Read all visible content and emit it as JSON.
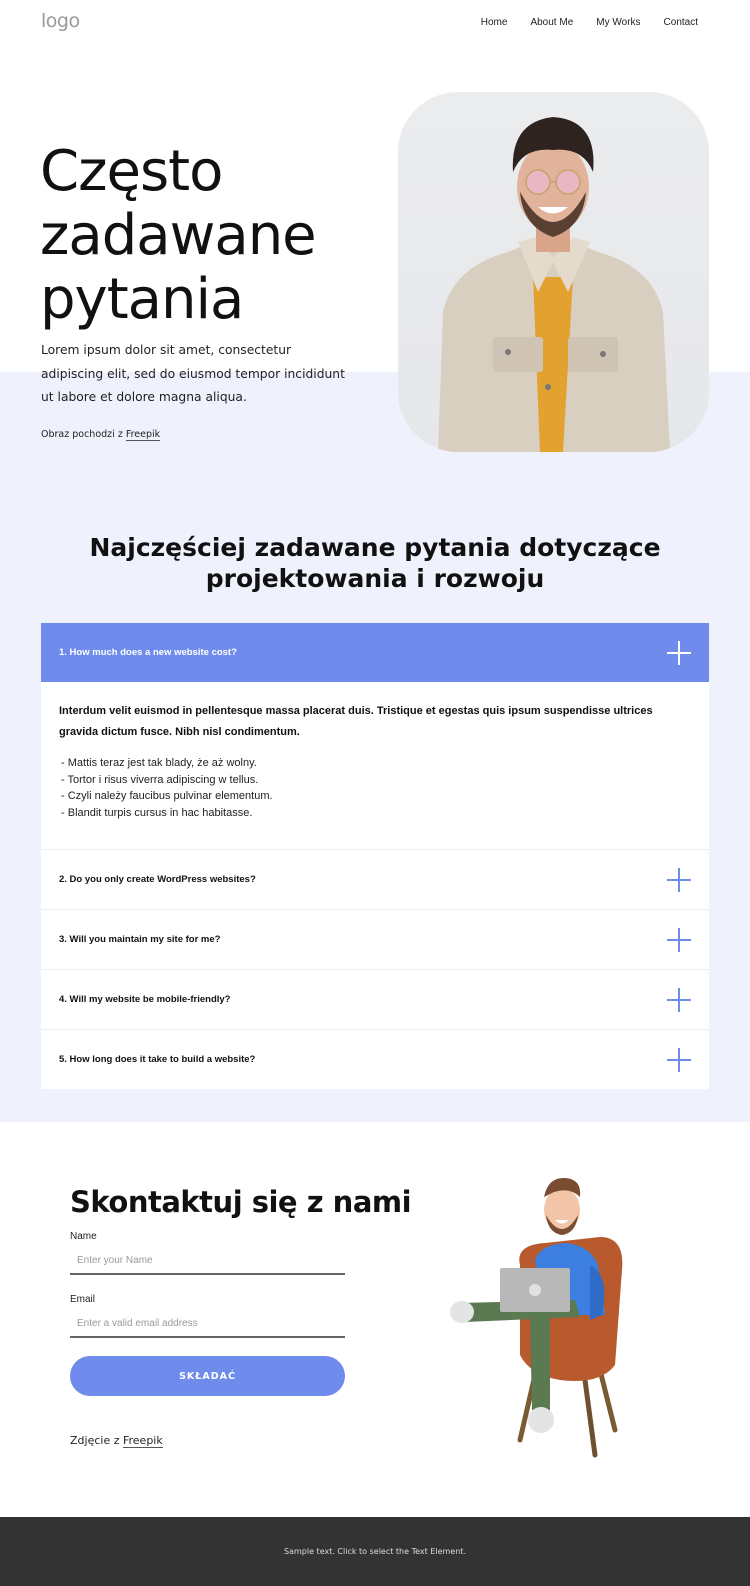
{
  "header": {
    "logo": "logo",
    "nav": [
      {
        "label": "Home"
      },
      {
        "label": "About Me"
      },
      {
        "label": "My Works"
      },
      {
        "label": "Contact"
      }
    ]
  },
  "hero": {
    "title_lines": [
      "Często",
      "zadawane",
      "pytania"
    ],
    "text": "Lorem ipsum dolor sit amet, consectetur adipiscing elit, sed do eiusmod tempor incididunt ut labore et dolore magna aliqua.",
    "credit_prefix": "Obraz pochodzi z ",
    "credit_link": "Freepik",
    "image_alt": "smiling man in beige denim jacket and pink glasses"
  },
  "faq": {
    "title_line1": "Najczęściej zadawane pytania dotyczące",
    "title_line2": "projektowania i rozwoju",
    "items": [
      {
        "question": "1. How much does a new website cost?",
        "expanded": true,
        "answer_lead": "Interdum velit euismod in pellentesque massa placerat duis. Tristique et egestas quis ipsum suspendisse ultrices gravida dictum fusce. Nibh nisl condimentum.",
        "answer_list": [
          "Mattis teraz jest tak blady, że aż wolny.",
          "Tortor i risus viverra adipiscing w tellus.",
          "Czyli należy faucibus pulvinar elementum.",
          "Blandit turpis cursus in hac habitasse."
        ]
      },
      {
        "question": "2. Do you only create WordPress websites?",
        "expanded": false
      },
      {
        "question": "3. Will you maintain my site for me?",
        "expanded": false
      },
      {
        "question": "4. Will my website be mobile-friendly?",
        "expanded": false
      },
      {
        "question": "5. How long does it take to build a website?",
        "expanded": false
      }
    ]
  },
  "contact": {
    "title": "Skontaktuj się z nami",
    "name_label": "Name",
    "name_placeholder": "Enter your Name",
    "email_label": "Email",
    "email_placeholder": "Enter a valid email address",
    "submit_label": "SKŁADAĆ",
    "credit_prefix": "Zdjęcie z ",
    "credit_link": "Freepik",
    "image_alt": "3D cartoon man sitting in chair with laptop"
  },
  "footer": {
    "text": "Sample text. Click to select the Text Element."
  },
  "colors": {
    "accent": "#6f8cec",
    "band_background": "#eff1fc",
    "footer_background": "#333333"
  }
}
